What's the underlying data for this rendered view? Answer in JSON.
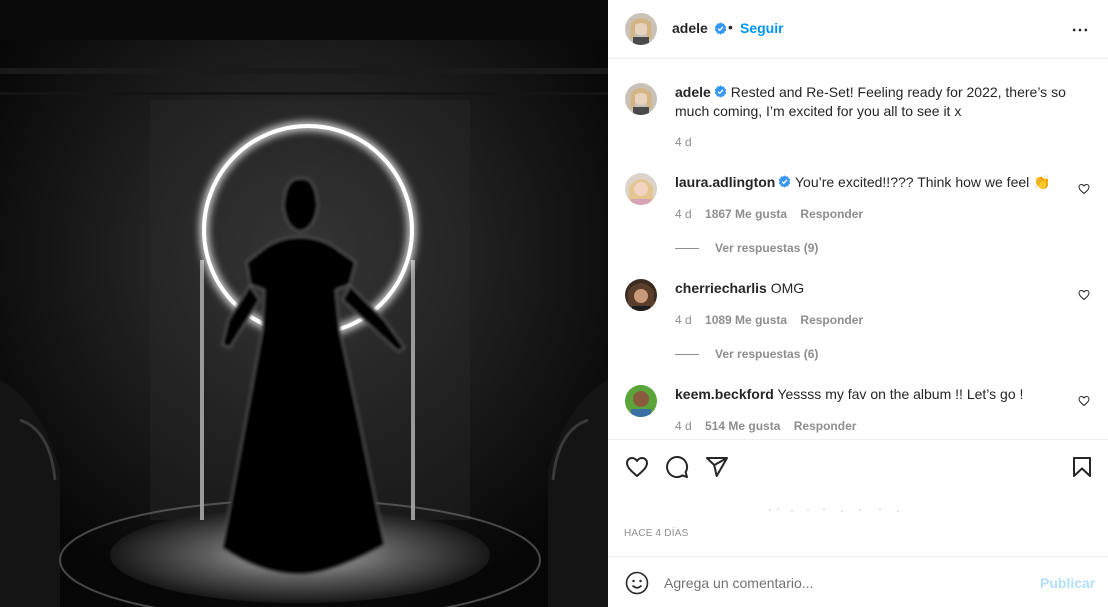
{
  "post": {
    "username": "adele",
    "dot": "•",
    "follow_label": "Seguir",
    "more_icon": "more-horizontal-icon",
    "caption_user": "adele",
    "caption_text": "Rested and Re-Set! Feeling ready for 2022, there’s so much coming, I’m excited for you all to see it x",
    "caption_time": "4 d"
  },
  "comments": [
    {
      "user": "laura.adlington",
      "verified": true,
      "text": "You’re excited!!??? Think how we feel 👏",
      "time": "4 d",
      "likes": "1867 Me gusta",
      "reply_label": "Responder",
      "view_replies": "Ver respuestas (9)"
    },
    {
      "user": "cherriecharlis",
      "verified": false,
      "text": "OMG",
      "time": "4 d",
      "likes": "1089 Me gusta",
      "reply_label": "Responder",
      "view_replies": "Ver respuestas (6)"
    },
    {
      "user": "keem.beckford",
      "verified": false,
      "text": "Yessss my fav on the album !! Let’s go !",
      "time": "4 d",
      "likes": "514 Me gusta",
      "reply_label": "Responder"
    }
  ],
  "actions": {
    "icons": [
      "heart-icon",
      "comment-icon",
      "share-icon",
      "bookmark-icon"
    ],
    "date_label": "HACE 4 DÍAS"
  },
  "add_comment": {
    "placeholder": "Agrega un comentario...",
    "post_label": "Publicar"
  },
  "colors": {
    "accent": "#0095f6",
    "verified": "#3897f0",
    "muted": "#8e8e8e",
    "post_disabled": "#b2dffc",
    "media_bg": "#0b0b0b"
  }
}
